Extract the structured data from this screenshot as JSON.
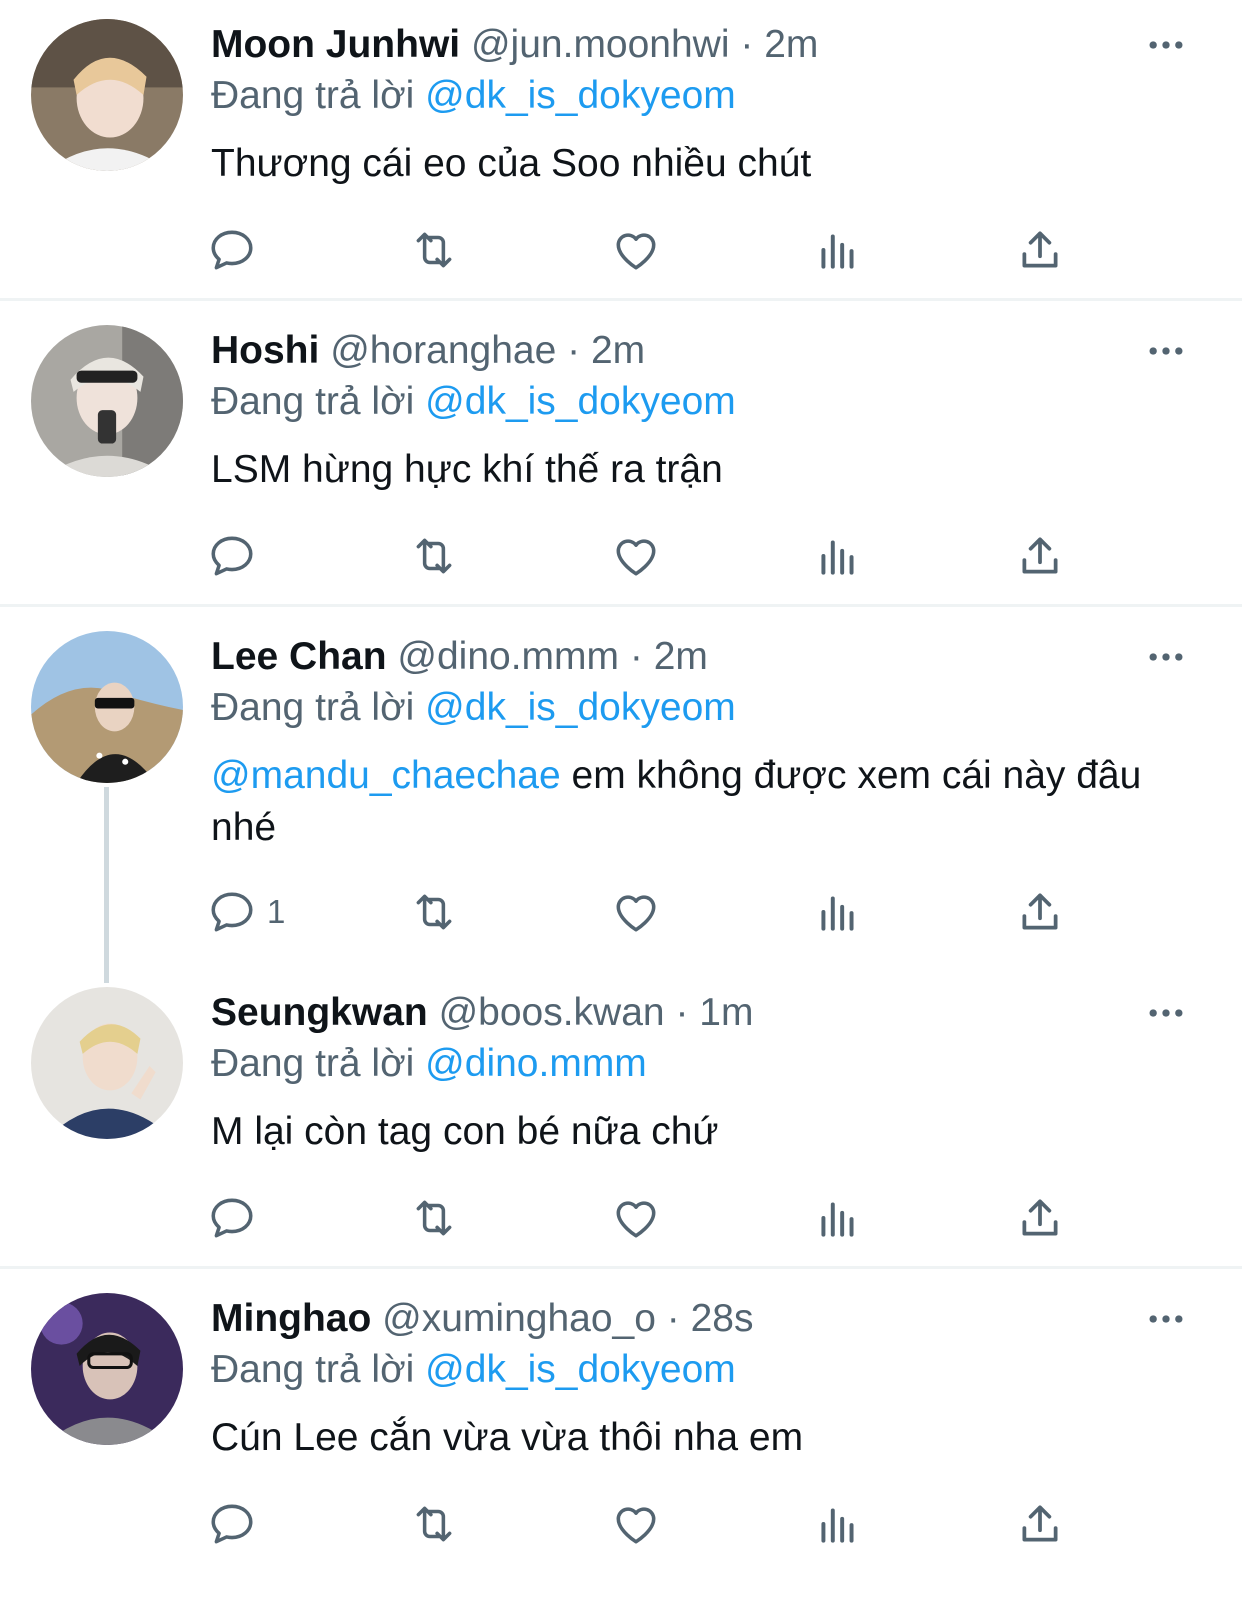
{
  "colors": {
    "accent": "#1d9bf0",
    "text": "#0f1419",
    "muted": "#536471",
    "divider": "#eff3f4",
    "thread": "#cfd9de"
  },
  "icons": {
    "reply": "reply-icon",
    "retweet": "retweet-icon",
    "like": "heart-icon",
    "views": "views-icon",
    "share": "share-icon",
    "more": "more-icon"
  },
  "tweets": [
    {
      "name": "Moon Junhwi",
      "handle": "@jun.moonhwi",
      "sep": "·",
      "time": "2m",
      "reply_prefix": "Đang trả lời",
      "reply_to": "@dk_is_dokyeom",
      "mention": "",
      "text": "Thương cái eo của Soo nhiều chút",
      "reply_count": ""
    },
    {
      "name": "Hoshi",
      "handle": "@horanghae",
      "sep": "·",
      "time": "2m",
      "reply_prefix": "Đang trả lời",
      "reply_to": "@dk_is_dokyeom",
      "mention": "",
      "text": "LSM hừng hực khí thế ra trận",
      "reply_count": ""
    },
    {
      "name": "Lee Chan",
      "handle": "@dino.mmm",
      "sep": "·",
      "time": "2m",
      "reply_prefix": "Đang trả lời",
      "reply_to": "@dk_is_dokyeom",
      "mention": "@mandu_chaechae",
      "text": " em không được xem cái này đâu nhé",
      "reply_count": "1"
    },
    {
      "name": "Seungkwan",
      "handle": "@boos.kwan",
      "sep": "·",
      "time": "1m",
      "reply_prefix": "Đang trả lời",
      "reply_to": "@dino.mmm",
      "mention": "",
      "text": "M lại còn tag con bé nữa chứ",
      "reply_count": ""
    },
    {
      "name": "Minghao",
      "handle": "@xuminghao_o",
      "sep": "·",
      "time": "28s",
      "reply_prefix": "Đang trả lời",
      "reply_to": "@dk_is_dokyeom",
      "mention": "",
      "text": "Cún Lee cắn vừa vừa thôi nha em",
      "reply_count": ""
    }
  ]
}
